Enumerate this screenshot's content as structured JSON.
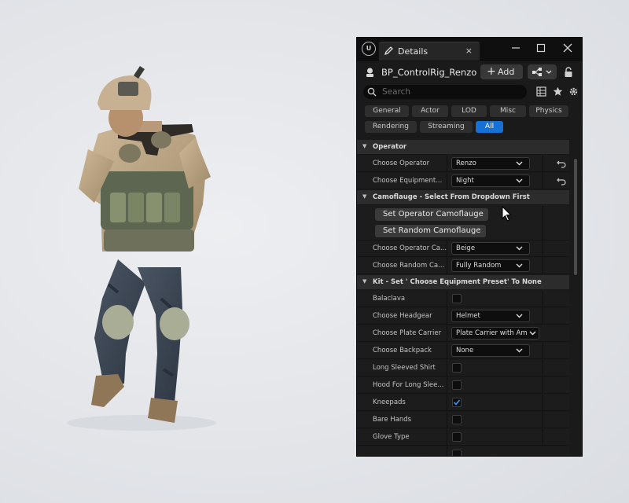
{
  "window": {
    "tab_title": "Details",
    "logo_text": "U"
  },
  "header": {
    "actor_name": "BP_ControlRig_Renzo",
    "add_label": "Add"
  },
  "search": {
    "placeholder": "Search"
  },
  "filters": [
    "General",
    "Actor",
    "LOD",
    "Misc",
    "Physics",
    "Rendering",
    "Streaming",
    "All"
  ],
  "active_filter": "All",
  "categories": {
    "operator": "Operator",
    "camo": "Camoflauge - Select From Dropdown First",
    "kit": "Kit - Set ' Choose Equipment Preset' To None"
  },
  "props": {
    "choose_operator": {
      "label": "Choose Operator",
      "value": "Renzo"
    },
    "choose_equipment": {
      "label": "Choose Equipment...",
      "value": "Night"
    },
    "set_operator_camo": "Set Operator Camoflauge",
    "set_random_camo": "Set Random Camoflauge",
    "choose_operator_camo": {
      "label": "Choose Operator Ca...",
      "value": "Beige"
    },
    "choose_random_camo": {
      "label": "Choose Random Ca...",
      "value": "Fully Random"
    },
    "balaclava": {
      "label": "Balaclava",
      "checked": false
    },
    "choose_headgear": {
      "label": "Choose Headgear",
      "value": "Helmet"
    },
    "choose_plate_carrier": {
      "label": "Choose Plate Carrier",
      "value": "Plate Carrier with Am"
    },
    "choose_backpack": {
      "label": "Choose Backpack",
      "value": "None"
    },
    "long_sleeved_shirt": {
      "label": "Long Sleeved Shirt",
      "checked": false
    },
    "hood": {
      "label": "Hood For Long Slee...",
      "checked": false
    },
    "kneepads": {
      "label": "Kneepads",
      "checked": true
    },
    "bare_hands": {
      "label": "Bare Hands",
      "checked": false
    },
    "glove_type": {
      "label": "Glove Type",
      "checked": false
    }
  },
  "colors": {
    "accent": "#1571d6",
    "panel_bg": "#1a1a1a",
    "viewport_bg": "#e3e5e9"
  }
}
